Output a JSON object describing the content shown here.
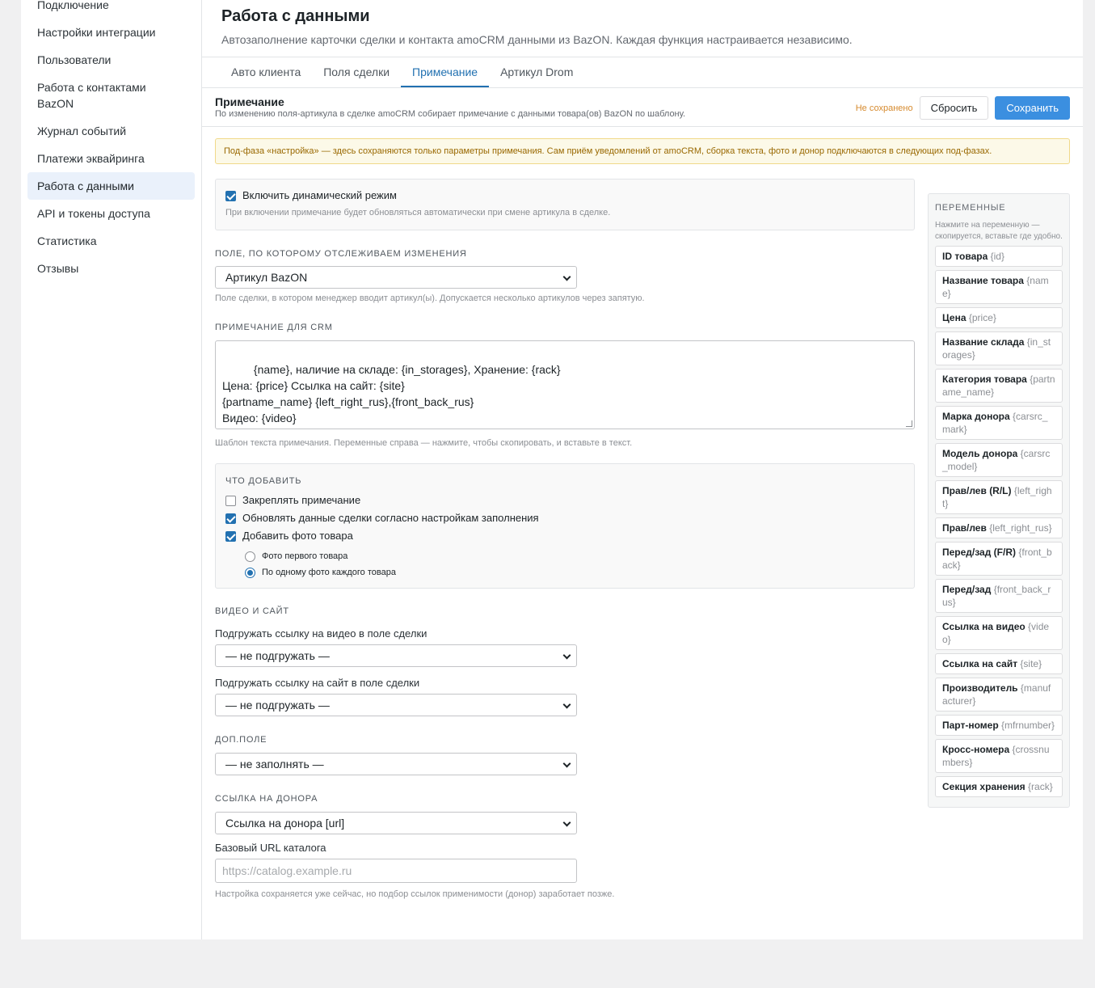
{
  "sidebar": {
    "items": [
      {
        "label": "Подключение"
      },
      {
        "label": "Настройки интеграции"
      },
      {
        "label": "Пользователи"
      },
      {
        "label": "Работа с контактами BazON"
      },
      {
        "label": "Журнал событий"
      },
      {
        "label": "Платежи эквайринга"
      },
      {
        "label": "Работа с данными"
      },
      {
        "label": "API и токены доступа"
      },
      {
        "label": "Статистика"
      },
      {
        "label": "Отзывы"
      }
    ]
  },
  "page": {
    "title": "Работа с данными",
    "subtitle": "Автозаполнение карточки сделки и контакта amoCRM данными из BazON. Каждая функция настраивается независимо."
  },
  "tabs": [
    {
      "label": "Авто клиента"
    },
    {
      "label": "Поля сделки"
    },
    {
      "label": "Примечание"
    },
    {
      "label": "Артикул Drom"
    }
  ],
  "section": {
    "title": "Примечание",
    "description": "По изменению поля-артикула в сделке amoCRM собирает примечание с данными товара(ов) BazON по шаблону.",
    "status": "Не сохранено",
    "reset_label": "Сбросить",
    "save_label": "Сохранить"
  },
  "notice": "Под-фаза «настройка» — здесь сохраняются только параметры примечания. Сам приём уведомлений от amoCRM, сборка текста, фото и донор подключаются в следующих под-фазах.",
  "dynamic": {
    "label": "Включить динамический режим",
    "checked": true,
    "hint": "При включении примечание будет обновляться автоматически при смене артикула в сделке."
  },
  "track_field": {
    "label": "Поле, по которому отслеживаем изменения",
    "value": "Артикул BazON",
    "hint": "Поле сделки, в котором менеджер вводит артикул(ы). Допускается несколько артикулов через запятую."
  },
  "crm_note": {
    "label": "Примечание для CRM",
    "value": "{name}, наличие на складе: {in_storages}, Хранение: {rack}\nЦена: {price} Ссылка на сайт: {site}\n{partname_name} {left_right_rus},{front_back_rus}\nВидео: {video}\nНомер детали: {mfrnumber}",
    "hint": "Шаблон текста примечания. Переменные справа — нажмите, чтобы скопировать, и вставьте в текст."
  },
  "add": {
    "label": "Что добавить",
    "pin_label": "Закреплять примечание",
    "pin_checked": false,
    "update_label": "Обновлять данные сделки согласно настройкам заполнения",
    "update_checked": true,
    "photo_label": "Добавить фото товара",
    "photo_checked": true,
    "photo_first_label": "Фото первого товара",
    "photo_each_label": "По одному фото каждого товара",
    "photo_mode": "each"
  },
  "video_site": {
    "label": "Видео и сайт",
    "video_field_label": "Подгружать ссылку на видео в поле сделки",
    "video_field_value": "— не подгружать —",
    "site_field_label": "Подгружать ссылку на сайт в поле сделки",
    "site_field_value": "— не подгружать —"
  },
  "extra": {
    "label": "Доп.поле",
    "value": "— не заполнять —"
  },
  "donor": {
    "label": "Ссылка на донора",
    "value": "Ссылка на донора [url]",
    "base_url_label": "Базовый URL каталога",
    "base_url_placeholder": "https://catalog.example.ru",
    "hint": "Настройка сохраняется уже сейчас, но подбор ссылок применимости (донор) заработает позже."
  },
  "variables": {
    "title": "Переменные",
    "hint": "Нажмите на переменную — скопируется, вставьте где удобно.",
    "items": [
      {
        "name": "ID товара",
        "key": "{id}"
      },
      {
        "name": "Название товара",
        "key": "{name}"
      },
      {
        "name": "Цена",
        "key": "{price}"
      },
      {
        "name": "Название склада",
        "key": "{in_storages}"
      },
      {
        "name": "Категория товара",
        "key": "{partname_name}"
      },
      {
        "name": "Марка донора",
        "key": "{carsrc_mark}"
      },
      {
        "name": "Модель донора",
        "key": "{carsrc_model}"
      },
      {
        "name": "Прав/лев (R/L)",
        "key": "{left_right}"
      },
      {
        "name": "Прав/лев",
        "key": "{left_right_rus}"
      },
      {
        "name": "Перед/зад (F/R)",
        "key": "{front_back}"
      },
      {
        "name": "Перед/зад",
        "key": "{front_back_rus}"
      },
      {
        "name": "Ссылка на видео",
        "key": "{video}"
      },
      {
        "name": "Ссылка на сайт",
        "key": "{site}"
      },
      {
        "name": "Производитель",
        "key": "{manufacturer}"
      },
      {
        "name": "Парт-номер",
        "key": "{mfrnumber}"
      },
      {
        "name": "Кросс-номера",
        "key": "{crossnumbers}"
      },
      {
        "name": "Секция хранения",
        "key": "{rack}"
      }
    ]
  }
}
